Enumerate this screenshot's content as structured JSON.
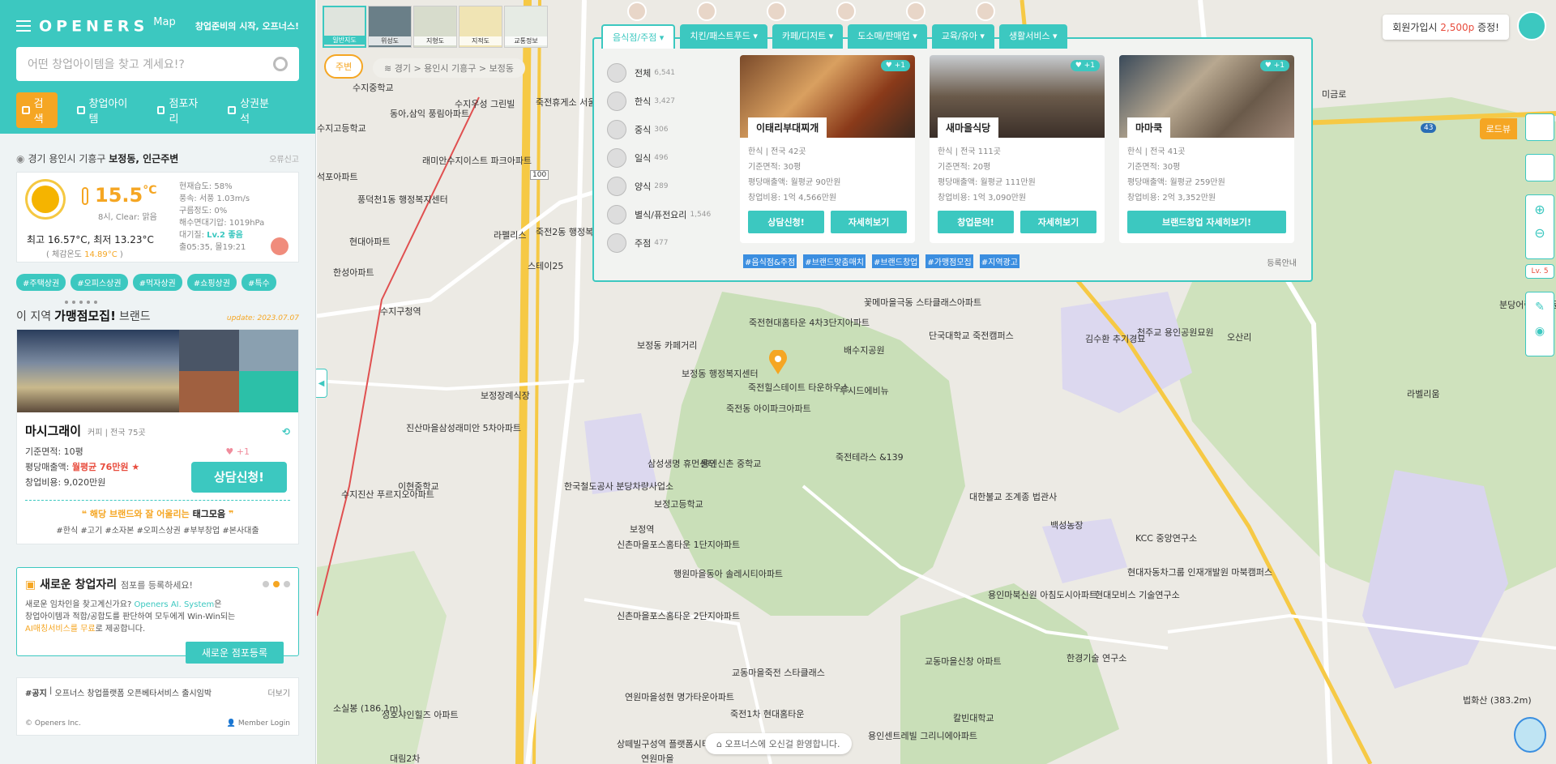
{
  "header": {
    "logo": "OPENERS",
    "logo_sup": "Map",
    "slogan": "창업준비의 시작, 오프너스!",
    "search_placeholder": "어떤 창업아이템을 찾고 계세요!?",
    "tabs": [
      {
        "label": "검색",
        "icon": "search-icon"
      },
      {
        "label": "창업아이템",
        "icon": "shop-icon"
      },
      {
        "label": "점포자리",
        "icon": "location-icon"
      },
      {
        "label": "상권분석",
        "icon": "chart-icon"
      }
    ]
  },
  "location": {
    "prefix": "경기 용인시 기흥구",
    "place": "보정동, 인근주변",
    "report": "오류신고"
  },
  "weather": {
    "temp": "15.5",
    "unit": "°C",
    "condition": "8시, Clear: 맑음",
    "minmax": "최고 16.57°C, 최저 13.23°C",
    "feel_label": "( 체감온도",
    "feel_value": "14.89°C",
    "feel_close": ")",
    "humidity": "현재습도: 58%",
    "wind": "풍속: 서풍 1.03m/s",
    "cloud": "구름정도: 0%",
    "pressure": "해수면대기압: 1019hPa",
    "air_label": "대기질:",
    "air_level": "Lv.2 좋음",
    "sun": "출05:35, 몰19:21"
  },
  "area_tags": [
    "#주택상권",
    "#오피스상권",
    "#먹자상권",
    "#쇼핑상권",
    "#특수"
  ],
  "brand_section": {
    "title_pre": "이 지역",
    "title_bold": "가맹점모집!",
    "title_post": "브랜드",
    "update": "update: 2023.07.07",
    "name": "마시그래이",
    "sub": "커피 | 전국 75곳",
    "likes": "+1",
    "area": "기준면적: 10평",
    "sales_label": "평당매출액:",
    "sales_value": "월평균 76만원 ★",
    "cost": "창업비용: 9,020만원",
    "consult_button": "상담신청!",
    "tag_quote_a": "해당 브랜드와 잘 어울리는",
    "tag_quote_b": "태그모음",
    "hashtags": "#한식 #고기 #소자본 #오피스상권 #부부창업 #본사대출"
  },
  "new_store": {
    "title": "새로운 창업자리",
    "subtitle": "점포를 등록하세요!",
    "line1_a": "새로운 임차인을 찾고계신가요?",
    "line1_b": "Openers AI. System",
    "line1_c": "은",
    "line2": "창업아이템과 적합/공합도를 판단하여 모두에게 Win-Win되는",
    "line3_a": "AI매칭서비스를 무료",
    "line3_b": "로 제공합니다.",
    "button": "새로운 점포등록"
  },
  "notice": {
    "tag": "#공지",
    "text": "오프너스 창업플랫폼 오픈베타서비스 출시임박",
    "more": "더보기",
    "copyright": "© Openers Inc.",
    "login": "Member Login"
  },
  "map_types": [
    "일반지도",
    "위성도",
    "지형도",
    "지적도",
    "교통정보"
  ],
  "map_controls": {
    "nearby": "주변",
    "breadcrumb": "경기 > 용인시 기흥구 > 보정동",
    "signup_a": "회원가입시",
    "signup_b": "2,500p",
    "signup_c": "증정!",
    "roadview": "로드뷰",
    "level": "Lv. 5",
    "welcome": "오프너스에 오신걸 환영합니다."
  },
  "categories": [
    "음식점/주점",
    "치킨/패스트푸드",
    "카페/디저트",
    "도소매/판매업",
    "교육/유아",
    "생활서비스"
  ],
  "sub_categories": [
    {
      "label": "전체",
      "count": "6,541"
    },
    {
      "label": "한식",
      "count": "3,427"
    },
    {
      "label": "중식",
      "count": "306"
    },
    {
      "label": "일식",
      "count": "496"
    },
    {
      "label": "양식",
      "count": "289"
    },
    {
      "label": "별식/퓨전요리",
      "count": "1,546"
    },
    {
      "label": "주점",
      "count": "477"
    }
  ],
  "cards": [
    {
      "name": "이태리부대찌개",
      "likes": "+1",
      "info1": "한식 | 전국 42곳",
      "info2": "기준면적: 30평",
      "info3": "평당매출액: 월평균 90만원",
      "info4": "창업비용: 1억 4,566만원",
      "btn1": "상담신청!",
      "btn2": "자세히보기"
    },
    {
      "name": "새마을식당",
      "likes": "+1",
      "info1": "한식 | 전국 111곳",
      "info2": "기준면적: 20평",
      "info3": "평당매출액: 월평균 111만원",
      "info4": "창업비용: 1억 3,090만원",
      "btn1": "창업문의!",
      "btn2": "자세히보기"
    },
    {
      "name": "마마쿡",
      "likes": "+1",
      "info1": "한식 | 전국 41곳",
      "info2": "기준면적: 30평",
      "info3": "평당매출액: 월평균 259만원",
      "info4": "창업비용: 2억 3,352만원",
      "btn1": "브랜드창업 자세히보기!"
    }
  ],
  "panel_tags": [
    "#음식점&주점",
    "#브랜드맞춤매치",
    "#브랜드창업",
    "#가맹점모집",
    "#지역광고"
  ],
  "panel_register": "등록안내",
  "map_labels": [
    "수지중학교",
    "동아,삼익 풍림아파트",
    "수지우성 그린빌",
    "죽전휴게소 서울방향",
    "석포아파트",
    "래미안수지이스트 파크아파트",
    "풍덕천1동 행정복지센터",
    "수지고등학교",
    "현대아파트",
    "라펠리스",
    "죽전2동 행정복지센터",
    "스테이25",
    "수지구청역",
    "보정동 카페거리",
    "보정동 행정복지센터",
    "죽전힐스테이트 타운하우스",
    "루시드에비뉴",
    "단국대학교 죽전캠퍼스",
    "배수지공원",
    "꽃메마을극동 스타클래스아파트",
    "죽전현대홈타운 4차3단지아파트",
    "죽전동 아이파크아파트",
    "죽전테라스 &139",
    "삼성생명 휴먼센터",
    "용인신촌 중학교",
    "한국철도공사 분당차량사업소",
    "보정고등학교",
    "보정역",
    "신촌마을포스홈타운 1단지아파트",
    "행원마을동아 솔레시티아파트",
    "대한불교 조계종 법관사",
    "백성농장",
    "KCC 중앙연구소",
    "현대자동차그룹 인재개발원 마북캠퍼스",
    "현대모비스 기술연구소",
    "한경기술 연구소",
    "용인마북신원 아침도시아파트",
    "교동마을신창 아파트",
    "용인센트레빌 그리니에아파트",
    "칼빈대학교",
    "천주교 용인공원묘원",
    "김수환 추기경묘",
    "오산리",
    "라벨리움",
    "분당어린이 전문대",
    "보정장례식장",
    "진산마을삼성래미안 5차아파트",
    "이현중학교",
    "수지진산 푸르지오아파트",
    "법화산 (383.2m)",
    "소실봉 (186.1m)",
    "한성아파트",
    "미금로",
    "연원마을",
    "신촌마을포스홈타운 2단지아파트",
    "연원마을성현 명가타운아파트",
    "상떼빌구성역 플랫폼시티아파트",
    "성호샤인힐즈 아파트",
    "대림2차",
    "죽전1차 현대홈타운",
    "교동마을죽전 스타클래스"
  ],
  "map_road_labels": [
    "100",
    "43"
  ]
}
